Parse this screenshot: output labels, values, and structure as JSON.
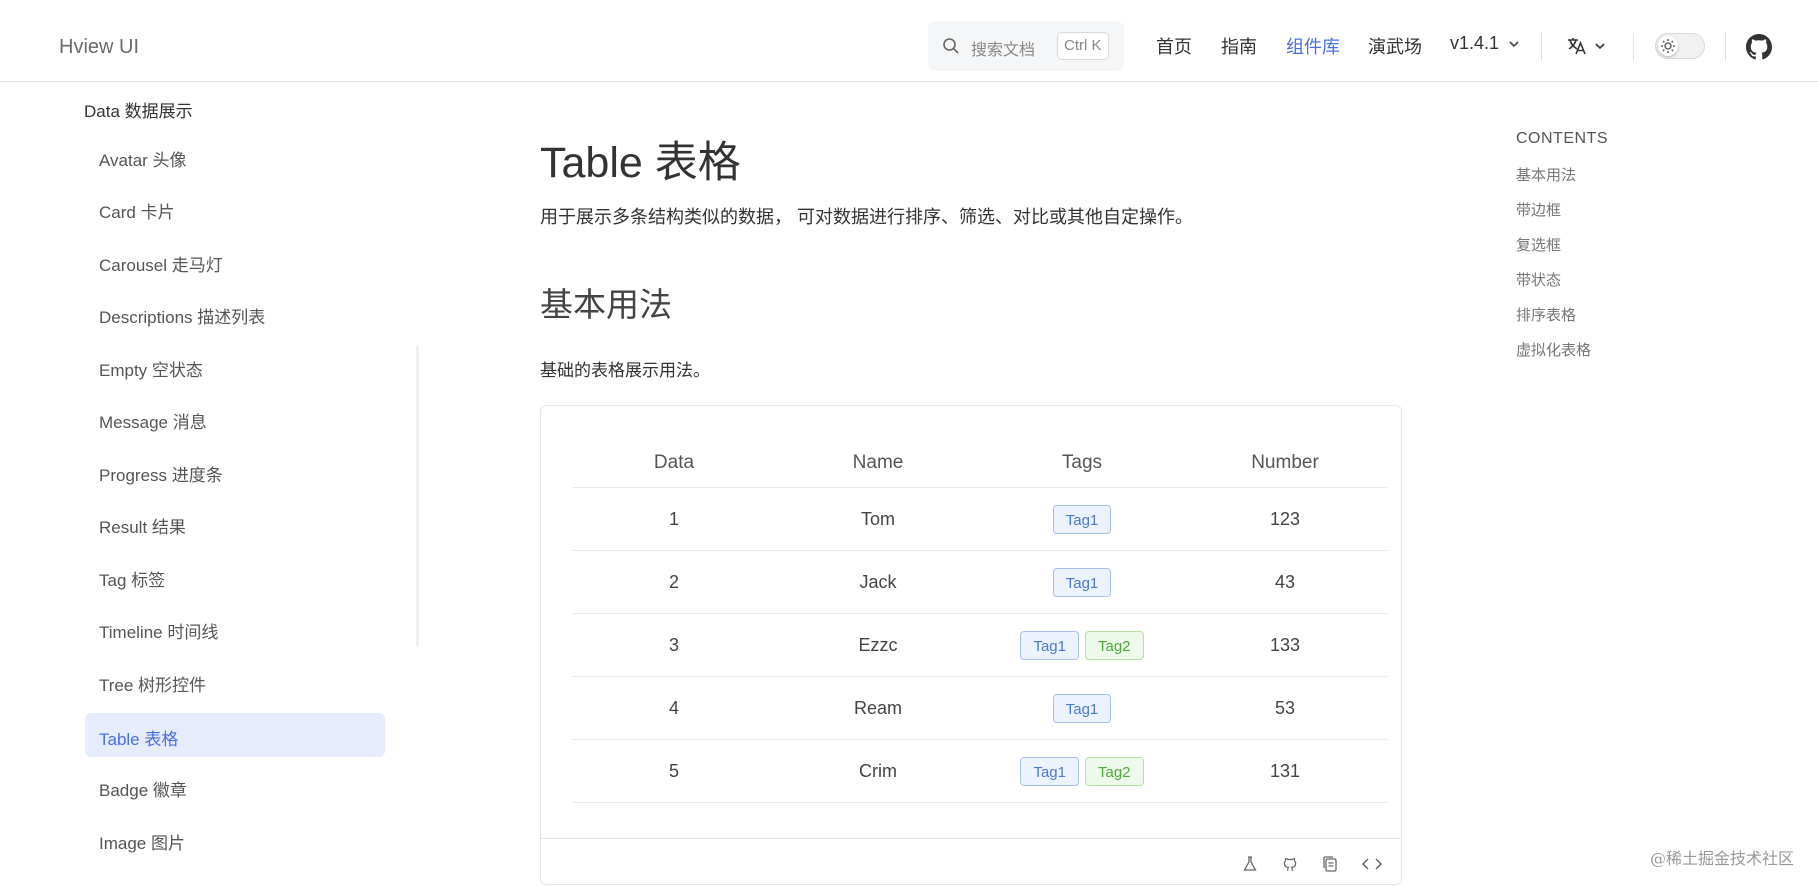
{
  "app": {
    "brand": "Hview UI",
    "search_placeholder": "搜索文档",
    "search_shortcut": "Ctrl K",
    "nav": [
      "首页",
      "指南",
      "组件库",
      "演武场"
    ],
    "active_nav_index": 2,
    "version": "v1.4.1"
  },
  "sidebar": {
    "group": "Data 数据展示",
    "items": [
      "Avatar 头像",
      "Card 卡片",
      "Carousel 走马灯",
      "Descriptions 描述列表",
      "Empty 空状态",
      "Message 消息",
      "Progress 进度条",
      "Result 结果",
      "Tag 标签",
      "Timeline 时间线",
      "Tree 树形控件",
      "Table 表格",
      "Badge 徽章",
      "Image 图片"
    ],
    "active_item": "Table 表格"
  },
  "main": {
    "title": "Table 表格",
    "lead": "用于展示多条结构类似的数据， 可对数据进行排序、筛选、对比或其他自定操作。",
    "section_title": "基本用法",
    "section_desc": "基础的表格展示用法。",
    "table": {
      "columns": [
        "Data",
        "Name",
        "Tags",
        "Number"
      ],
      "rows": [
        {
          "data": "1",
          "name": "Tom",
          "tags": [
            "Tag1"
          ],
          "number": "123"
        },
        {
          "data": "2",
          "name": "Jack",
          "tags": [
            "Tag1"
          ],
          "number": "43"
        },
        {
          "data": "3",
          "name": "Ezzc",
          "tags": [
            "Tag1",
            "Tag2"
          ],
          "number": "133"
        },
        {
          "data": "4",
          "name": "Ream",
          "tags": [
            "Tag1"
          ],
          "number": "53"
        },
        {
          "data": "5",
          "name": "Crim",
          "tags": [
            "Tag1",
            "Tag2"
          ],
          "number": "131"
        }
      ]
    }
  },
  "toc": {
    "title": "CONTENTS",
    "items": [
      "基本用法",
      "带边框",
      "复选框",
      "带状态",
      "排序表格",
      "虚拟化表格"
    ]
  },
  "watermark": "@稀土掘金技术社区",
  "colors": {
    "accent": "#4a6fe0",
    "active_bg": "#e6ecfc",
    "tag_blue": "#4a78d6",
    "tag_green": "#4fa83a"
  },
  "icons": {
    "search": "search-icon",
    "version_dropdown": "chevron-down-icon",
    "language": "translate-icon",
    "theme": "sun-icon",
    "repo": "github-icon",
    "footer": [
      "flask-icon",
      "github-icon",
      "copy-icon",
      "code-icon"
    ]
  }
}
